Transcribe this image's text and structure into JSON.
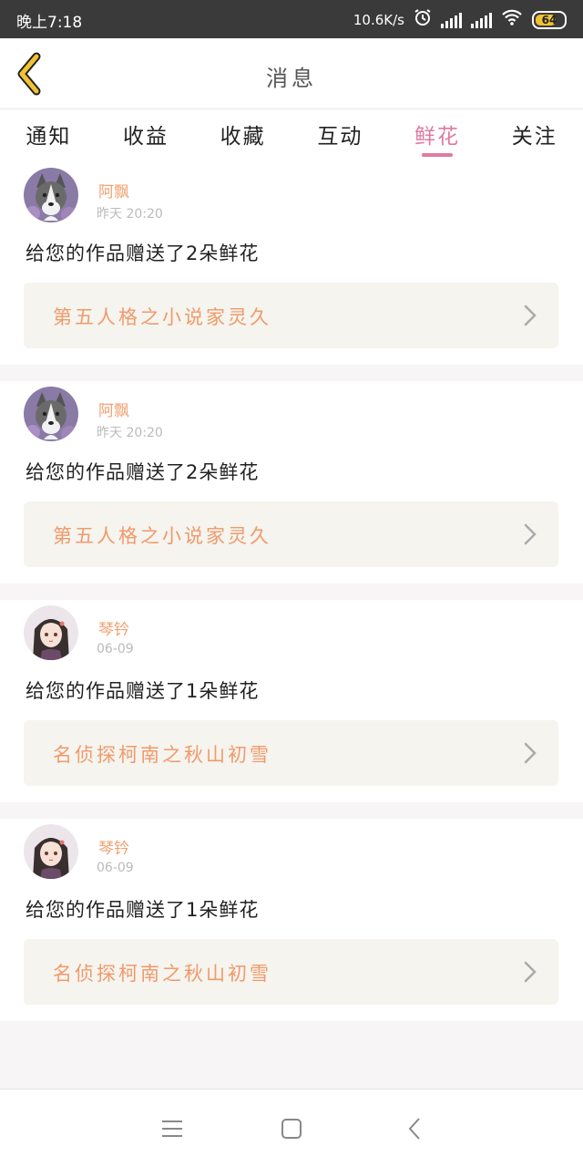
{
  "status_bar": {
    "time": "晚上7:18",
    "net_speed": "10.6K/s",
    "battery": "64",
    "icons": [
      "alarm-icon",
      "signal-icon",
      "signal-icon",
      "wifi-icon",
      "battery-icon"
    ]
  },
  "header": {
    "title": "消息",
    "back_icon": "chevron-left-icon"
  },
  "tabs": [
    {
      "label": "通知"
    },
    {
      "label": "收益"
    },
    {
      "label": "收藏"
    },
    {
      "label": "互动"
    },
    {
      "label": "鲜花",
      "active": true
    },
    {
      "label": "关注"
    }
  ],
  "messages": [
    {
      "user": "阿飘",
      "time": "昨天 20:20",
      "text": "给您的作品赠送了2朵鲜花",
      "work": "第五人格之小说家灵久",
      "avatar": "husky-dog-avatar"
    },
    {
      "user": "阿飘",
      "time": "昨天 20:20",
      "text": "给您的作品赠送了2朵鲜花",
      "work": "第五人格之小说家灵久",
      "avatar": "husky-dog-avatar"
    },
    {
      "user": "琴钤",
      "time": "06-09",
      "text": "给您的作品赠送了1朵鲜花",
      "work": "名侦探柯南之秋山初雪",
      "avatar": "anime-girl-avatar"
    },
    {
      "user": "琴钤",
      "time": "06-09",
      "text": "给您的作品赠送了1朵鲜花",
      "work": "名侦探柯南之秋山初雪",
      "avatar": "anime-girl-avatar"
    }
  ],
  "colors": {
    "accent": "#e07aa0",
    "username": "#f0a070",
    "work_title": "#f09a6c",
    "back_icon": "#f2c233"
  },
  "nav_bar": [
    "menu-icon",
    "home-square-icon",
    "back-triangle-icon"
  ]
}
